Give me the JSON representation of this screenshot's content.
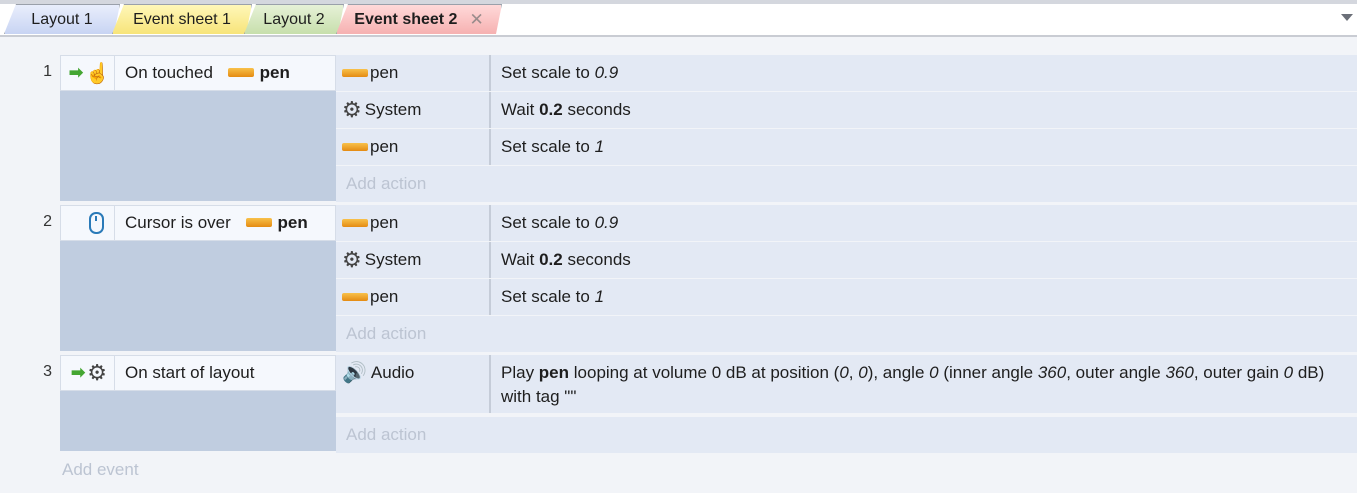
{
  "tabs": [
    {
      "label": "Layout 1"
    },
    {
      "label": "Event sheet 1"
    },
    {
      "label": "Layout 2"
    },
    {
      "label": "Event sheet 2",
      "close": "✕"
    }
  ],
  "events": [
    {
      "number": "1",
      "condition": {
        "prefix": "On touched",
        "object": "pen",
        "icons": [
          "green-arrow-icon",
          "touch-hand-icon"
        ]
      },
      "actions": [
        {
          "object": "pen",
          "icon": "sprite-icon",
          "text": "Set scale to ",
          "value": "0.9"
        },
        {
          "object": "System",
          "icon": "gear-icon",
          "text_before": "Wait ",
          "value": "0.2",
          "text_after": " seconds"
        },
        {
          "object": "pen",
          "icon": "sprite-icon",
          "text": "Set scale to ",
          "value": "1"
        }
      ],
      "add_action": "Add action"
    },
    {
      "number": "2",
      "condition": {
        "prefix": "Cursor is over",
        "object": "pen",
        "icons": [
          "mouse-icon"
        ]
      },
      "actions": [
        {
          "object": "pen",
          "icon": "sprite-icon",
          "text": "Set scale to ",
          "value": "0.9"
        },
        {
          "object": "System",
          "icon": "gear-icon",
          "text_before": "Wait ",
          "value": "0.2",
          "text_after": " seconds"
        },
        {
          "object": "pen",
          "icon": "sprite-icon",
          "text": "Set scale to ",
          "value": "1"
        }
      ],
      "add_action": "Add action"
    },
    {
      "number": "3",
      "condition": {
        "prefix": "On start of layout",
        "icons": [
          "green-arrow-icon",
          "gear-icon"
        ]
      },
      "actions": [
        {
          "object": "Audio",
          "icon": "speaker-icon",
          "p1": "Play ",
          "sound": "pen",
          "p2": " looping at volume 0 dB at position (",
          "x": "0",
          "p3": ", ",
          "y": "0",
          "p4": "), angle ",
          "angle": "0",
          "p5": " (inner angle ",
          "inner": "360",
          "p6": ", outer angle ",
          "outer": "360",
          "p7": ", outer gain ",
          "gain": "0",
          "p8": " dB) with tag \"\""
        }
      ],
      "add_action": "Add action"
    }
  ],
  "add_event": "Add event"
}
